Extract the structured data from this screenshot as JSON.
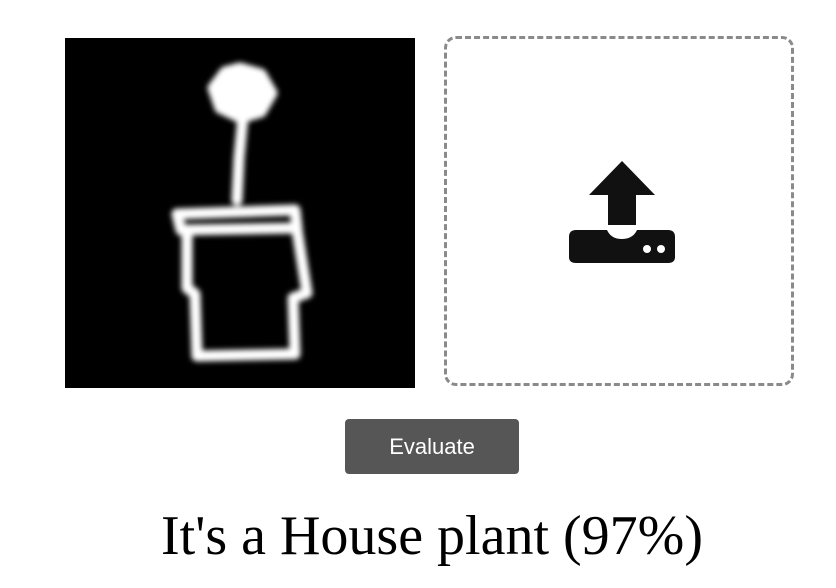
{
  "canvas": {
    "background_color": "#000000",
    "stroke_color": "#ffffff"
  },
  "upload": {
    "icon": "upload-icon",
    "border_color": "#8a8a8a"
  },
  "actions": {
    "evaluate_label": "Evaluate",
    "button_color": "#565656"
  },
  "result": {
    "text": "It's a House plant (97%)"
  }
}
